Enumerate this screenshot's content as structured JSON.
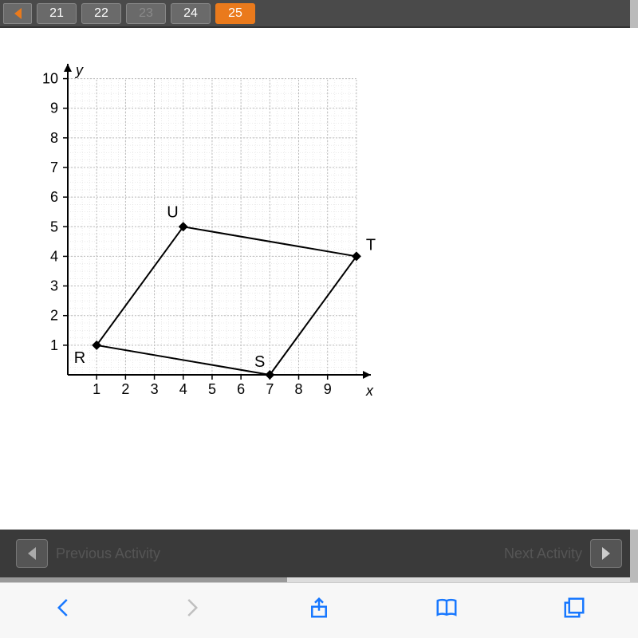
{
  "topnav": {
    "pages": [
      {
        "label": "21",
        "state": "norm"
      },
      {
        "label": "22",
        "state": "norm"
      },
      {
        "label": "23",
        "state": "disabled"
      },
      {
        "label": "24",
        "state": "norm"
      },
      {
        "label": "25",
        "state": "active"
      }
    ]
  },
  "activity": {
    "prev_label": "Previous Activity",
    "next_label": "Next Activity"
  },
  "chart_data": {
    "type": "scatter",
    "title": "",
    "xlabel": "x",
    "ylabel": "y",
    "xlim": [
      0,
      10.5
    ],
    "ylim": [
      0,
      10.5
    ],
    "xticks": [
      1,
      2,
      3,
      4,
      5,
      6,
      7,
      8,
      9
    ],
    "yticks": [
      1,
      2,
      3,
      4,
      5,
      6,
      7,
      8,
      9,
      10
    ],
    "points": [
      {
        "name": "R",
        "x": 1,
        "y": 1,
        "label_pos": "bl"
      },
      {
        "name": "S",
        "x": 7,
        "y": 0,
        "label_pos": "tl"
      },
      {
        "name": "T",
        "x": 10,
        "y": 4,
        "label_pos": "tr"
      },
      {
        "name": "U",
        "x": 4,
        "y": 5,
        "label_pos": "tl"
      }
    ],
    "polygon_order": [
      "R",
      "S",
      "T",
      "U"
    ]
  }
}
